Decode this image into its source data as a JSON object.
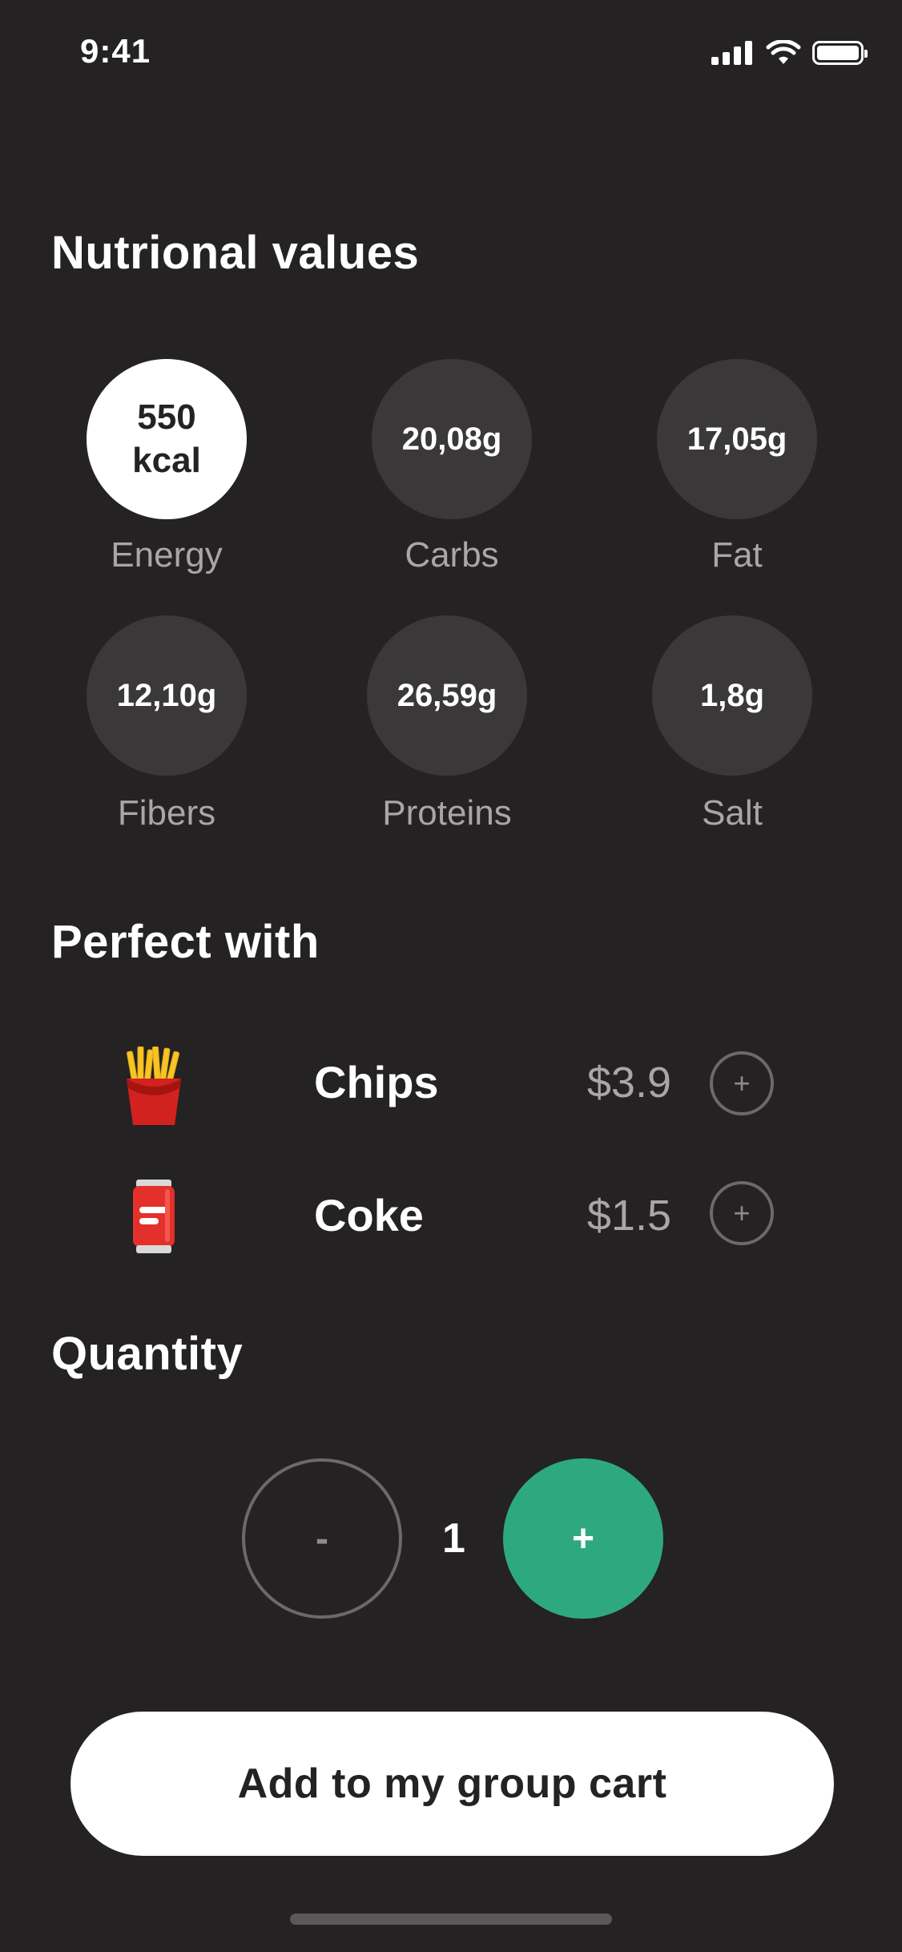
{
  "status_bar": {
    "time": "9:41"
  },
  "nutrition": {
    "title": "Nutrional values",
    "items": [
      {
        "value_line1": "550",
        "value_line2": "kcal",
        "label": "Energy"
      },
      {
        "value": "20,08g",
        "label": "Carbs"
      },
      {
        "value": "17,05g",
        "label": "Fat"
      },
      {
        "value": "12,10g",
        "label": "Fibers"
      },
      {
        "value": "26,59g",
        "label": "Proteins"
      },
      {
        "value": "1,8g",
        "label": "Salt"
      }
    ]
  },
  "perfect_with": {
    "title": "Perfect with",
    "items": [
      {
        "name": "Chips",
        "price": "$3.9",
        "icon": "fries-icon",
        "add": "+"
      },
      {
        "name": "Coke",
        "price": "$1.5",
        "icon": "soda-can-icon",
        "add": "+"
      }
    ]
  },
  "quantity": {
    "title": "Quantity",
    "minus": "-",
    "value": "1",
    "plus": "+"
  },
  "cart": {
    "button_label": "Add to my group cart"
  },
  "colors": {
    "background": "#242223",
    "accent": "#2ea97f",
    "circle": "#3a3839",
    "muted_text": "#a8a6a7"
  }
}
